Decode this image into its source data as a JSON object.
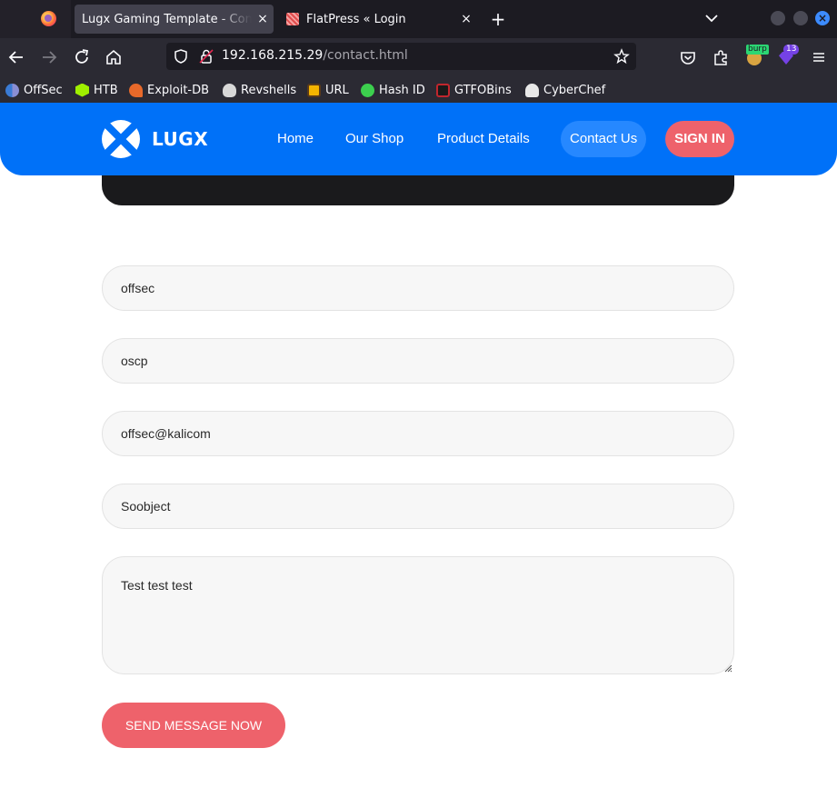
{
  "browser": {
    "tabs": [
      {
        "title": "Lugx Gaming Template - Contact",
        "active": true
      },
      {
        "title": "FlatPress « Login",
        "active": false
      }
    ],
    "close_glyph": "×",
    "new_tab_glyph": "+",
    "url_host": "192.168.215.29",
    "url_path": "/contact.html",
    "ext_badge_burp": "burp",
    "ext_badge_count": "13",
    "bookmarks": [
      "OffSec",
      "HTB",
      "Exploit-DB",
      "Revshells",
      "URL",
      "Hash ID",
      "GTFOBins",
      "CyberChef"
    ]
  },
  "header": {
    "logo_text": "LUGX",
    "nav": [
      "Home",
      "Our Shop",
      "Product Details",
      "Contact Us"
    ],
    "signin_label": "SIGN IN",
    "brand_color": "#0071f8",
    "accent_color": "#ee626b"
  },
  "form": {
    "name_value": "offsec",
    "surname_value": "oscp",
    "email_value": "offsec@kalicom",
    "subject_value": "Soobject",
    "message_value": "Test test test",
    "submit_label": "SEND MESSAGE NOW"
  }
}
